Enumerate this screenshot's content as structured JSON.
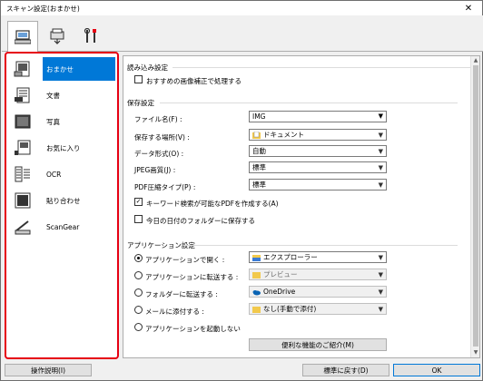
{
  "window": {
    "title": "スキャン設定(おまかせ)",
    "close_glyph": "✕"
  },
  "tabs": [
    {
      "name": "scan-from-computer",
      "active": true
    },
    {
      "name": "scan-from-operation-panel",
      "active": false
    },
    {
      "name": "general-settings",
      "active": false
    }
  ],
  "sidebar": {
    "items": [
      {
        "label": "おまかせ",
        "icon": "auto-scan-icon",
        "selected": true
      },
      {
        "label": "文書",
        "icon": "document-icon",
        "selected": false
      },
      {
        "label": "写真",
        "icon": "photo-icon",
        "selected": false
      },
      {
        "label": "お気に入り",
        "icon": "favorite-icon",
        "selected": false
      },
      {
        "label": "OCR",
        "icon": "ocr-icon",
        "selected": false
      },
      {
        "label": "貼り合わせ",
        "icon": "stitch-icon",
        "selected": false
      },
      {
        "label": "ScanGear",
        "icon": "scangear-icon",
        "selected": false
      }
    ]
  },
  "scan_options": {
    "title": "読み込み設定",
    "recommended_correction": {
      "label": "おすすめの画像補正で処理する",
      "checked": false
    }
  },
  "save_settings": {
    "title": "保存設定",
    "file_name": {
      "label": "ファイル名(F) :",
      "value": "IMG"
    },
    "save_in": {
      "label": "保存する場所(V) :",
      "value": "ドキュメント"
    },
    "data_format": {
      "label": "データ形式(O) :",
      "value": "自動"
    },
    "jpeg_quality": {
      "label": "JPEG画質(J) :",
      "value": "標準"
    },
    "pdf_compression": {
      "label": "PDF圧縮タイプ(P) :",
      "value": "標準"
    },
    "keyword_pdf": {
      "label": "キーワード検索が可能なPDFを作成する(A)",
      "checked": true
    },
    "today_folder": {
      "label": "今日の日付のフォルダーに保存する",
      "checked": false
    }
  },
  "app_settings": {
    "title": "アプリケーション設定",
    "options": [
      {
        "label": "アプリケーションで開く :",
        "selected": true,
        "value": "エクスプローラー",
        "icon": "explorer-icon",
        "enabled": true
      },
      {
        "label": "アプリケーションに転送する :",
        "selected": false,
        "value": "プレビュー",
        "icon": "folder-icon",
        "enabled": false
      },
      {
        "label": "フォルダーに転送する :",
        "selected": false,
        "value": "OneDrive",
        "icon": "onedrive-icon",
        "enabled": false
      },
      {
        "label": "メールに添付する :",
        "selected": false,
        "value": "なし(手動で添付)",
        "icon": "folder-icon",
        "enabled": false
      },
      {
        "label": "アプリケーションを起動しない",
        "selected": false,
        "value": null,
        "icon": null,
        "enabled": false
      }
    ],
    "useful_features_button": "便利な機能のご紹介(M)"
  },
  "footer": {
    "instructions_button": "操作説明(I)",
    "defaults_button": "標準に戻す(D)",
    "ok_button": "OK"
  }
}
